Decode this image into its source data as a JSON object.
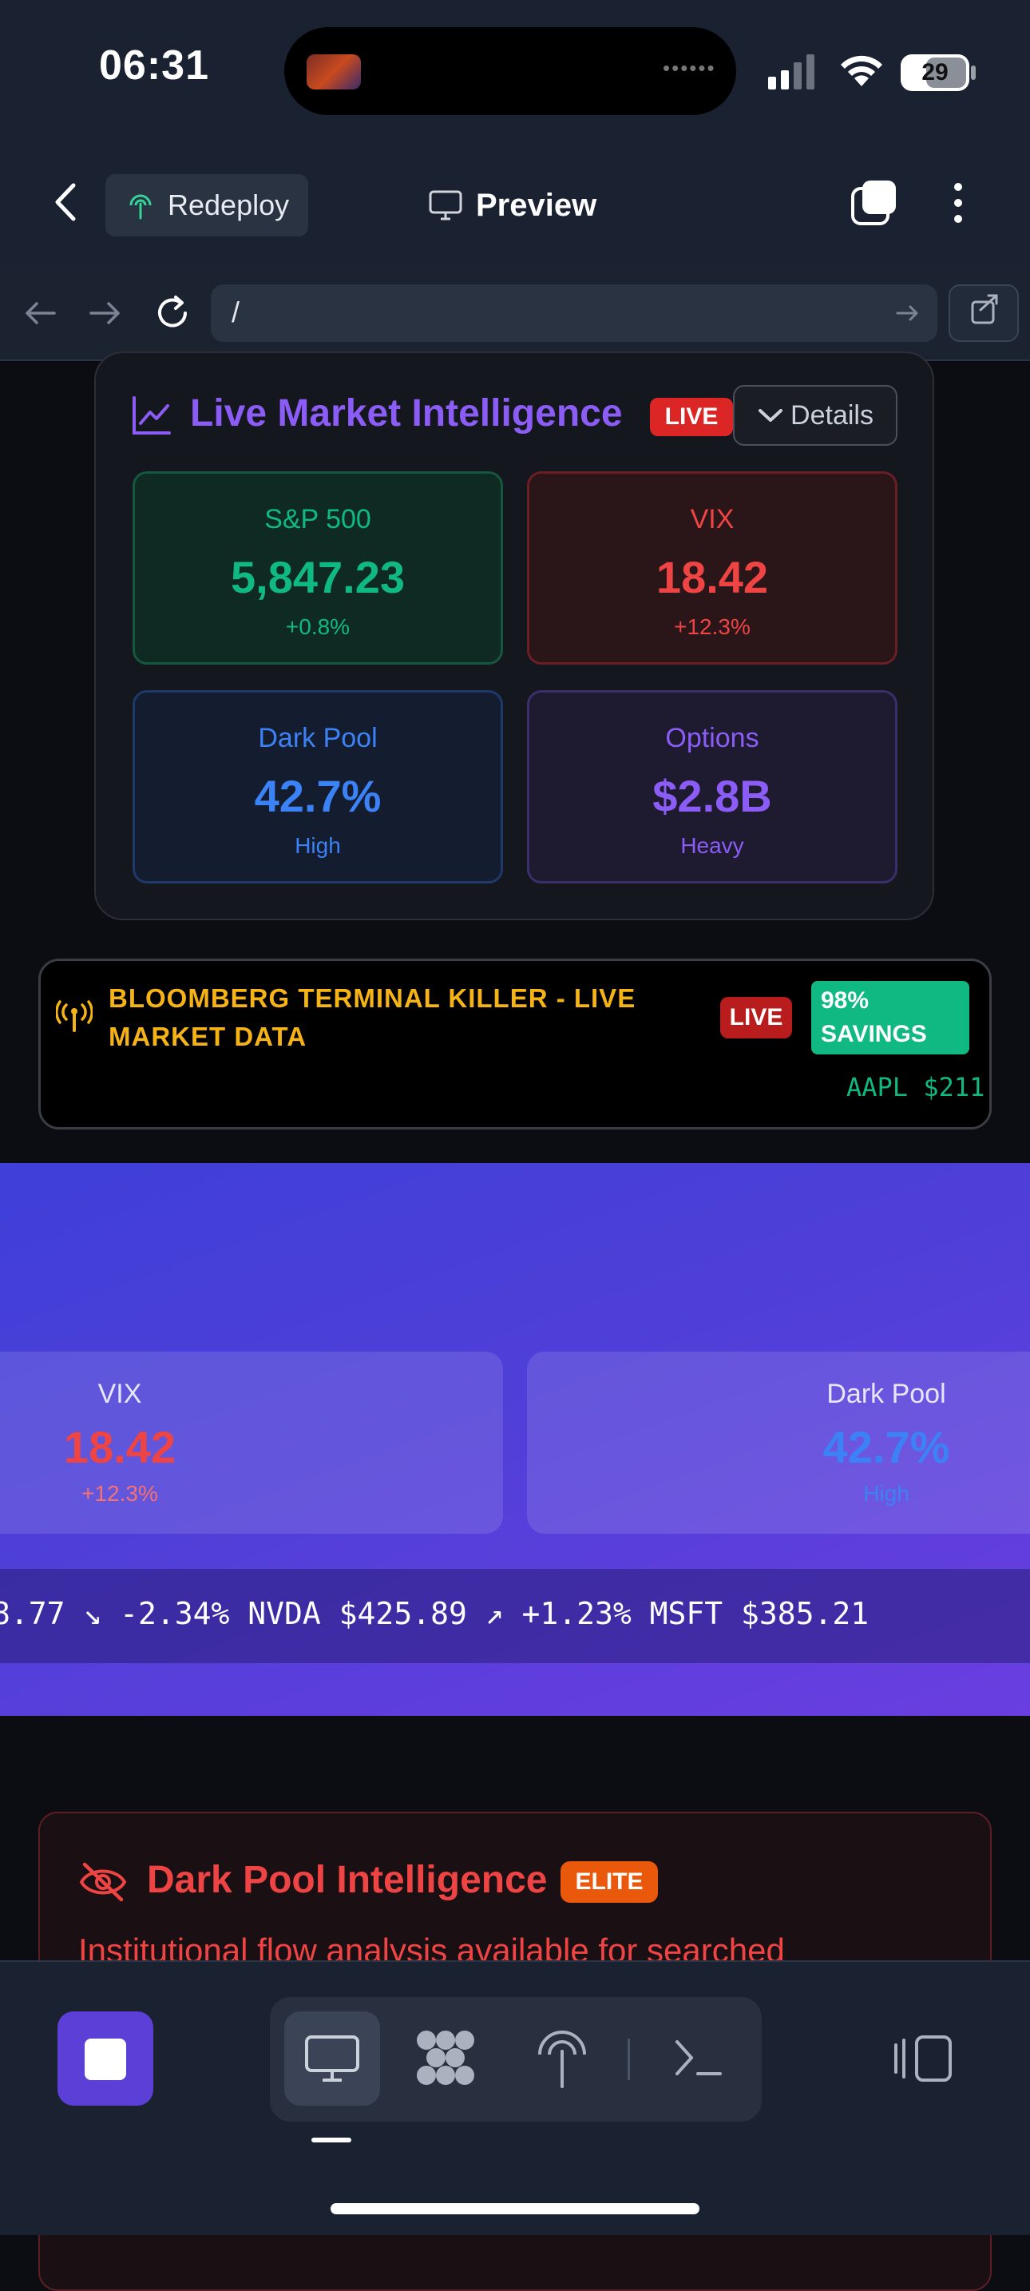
{
  "status_bar": {
    "time": "06:31",
    "battery": "29"
  },
  "app_bar": {
    "redeploy_label": "Redeploy",
    "preview_label": "Preview"
  },
  "browser": {
    "url": "/"
  },
  "market": {
    "title": "Live Market Intelligence",
    "live_badge": "LIVE",
    "details_label": "Details",
    "tiles": [
      {
        "label": "S&P 500",
        "value": "5,847.23",
        "sub": "+0.8%",
        "color": "#10b981"
      },
      {
        "label": "VIX",
        "value": "18.42",
        "sub": "+12.3%",
        "color": "#ef4444"
      },
      {
        "label": "Dark Pool",
        "value": "42.7%",
        "sub": "High",
        "color": "#3b82f6"
      },
      {
        "label": "Options",
        "value": "$2.8B",
        "sub": "Heavy",
        "color": "#8b5cf6"
      }
    ]
  },
  "terminal": {
    "title": "BLOOMBERG TERMINAL KILLER - LIVE MARKET DATA",
    "live_badge": "LIVE",
    "savings": "98% SAVINGS",
    "ticker": "AAPL $211"
  },
  "hero": {
    "tiles": [
      {
        "label": "VIX",
        "value": "18.42",
        "sub": "+12.3%"
      },
      {
        "label": "Dark Pool",
        "value": "42.7%",
        "sub": "High"
      }
    ],
    "ticker": "8.77 ↘ -2.34%     NVDA $425.89 ↗ +1.23%     MSFT $385.21"
  },
  "dark_pool": {
    "title": "Dark Pool Intelligence",
    "badge": "ELITE",
    "description": "Institutional flow analysis available for searched"
  },
  "colors": {
    "accent_purple": "#8b5cf6",
    "green": "#10b981",
    "red": "#ef4444",
    "blue": "#3b82f6",
    "amber": "#f5b316"
  }
}
